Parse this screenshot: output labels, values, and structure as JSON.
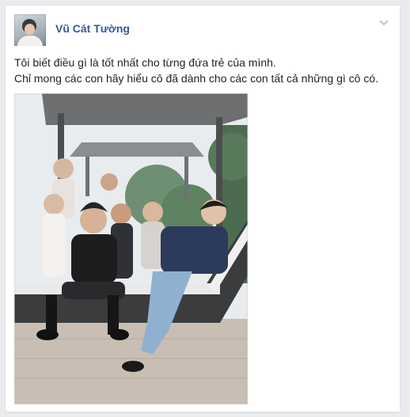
{
  "post": {
    "author": "Vũ Cát Tường",
    "text_lines": [
      "Tôi biết điều gì là tốt nhất cho từng đứa trẻ của mình.",
      "Chỉ mong các con hãy hiểu cô đã dành cho các con tất cả những gì cô có."
    ],
    "menu_icon": "chevron-down-icon",
    "avatar_icon": "profile-photo",
    "photo": "group-photo-children-on-lounger"
  },
  "colors": {
    "author_link": "#365899",
    "text": "#1d2129",
    "background": "#e9ebee",
    "card": "#ffffff"
  }
}
